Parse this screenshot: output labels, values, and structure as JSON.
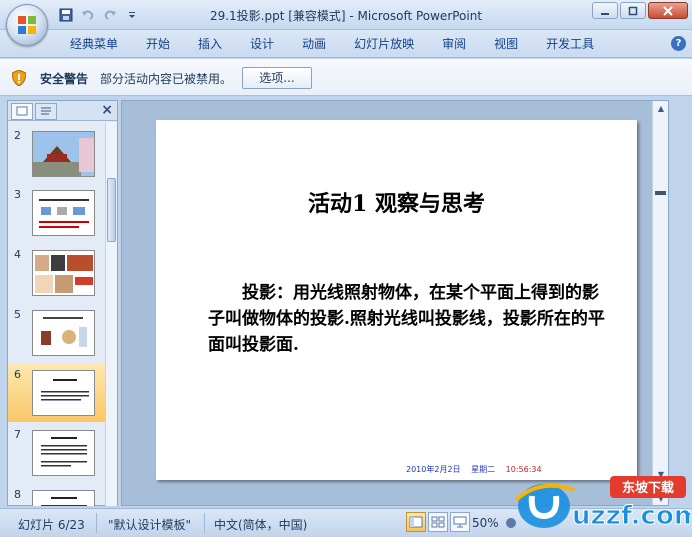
{
  "window": {
    "title": "29.1投影.ppt [兼容模式] - Microsoft PowerPoint"
  },
  "ribbon": {
    "tabs": [
      "经典菜单",
      "开始",
      "插入",
      "设计",
      "动画",
      "幻灯片放映",
      "审阅",
      "视图",
      "开发工具"
    ]
  },
  "security_bar": {
    "title": "安全警告",
    "message": "部分活动内容已被禁用。",
    "options_button": "选项..."
  },
  "slides_panel": {
    "slides": [
      {
        "number": "2"
      },
      {
        "number": "3"
      },
      {
        "number": "4"
      },
      {
        "number": "5"
      },
      {
        "number": "6",
        "selected": true
      },
      {
        "number": "7"
      },
      {
        "number": "8"
      }
    ]
  },
  "slide": {
    "title": "活动1 观察与思考",
    "body": "投影：用光线照射物体，在某个平面上得到的影子叫做物体的投影.照射光线叫投影线，投影所在的平面叫投影面.",
    "footer_date": "2010年2月2日",
    "footer_weekday": "星期二",
    "footer_time": "10:56:34"
  },
  "status_bar": {
    "slide_indicator": "幻灯片 6/23",
    "theme": "\"默认设计模板\"",
    "language": "中文(简体，中国)",
    "zoom": "50%"
  },
  "watermark": {
    "brand": "uzzf.com",
    "sub": "东坡下载"
  },
  "colors": {
    "accent": "#15428b",
    "selected_thumb": "#f9c768",
    "footer_blue": "#1f3ac4",
    "footer_red": "#c0282b"
  }
}
